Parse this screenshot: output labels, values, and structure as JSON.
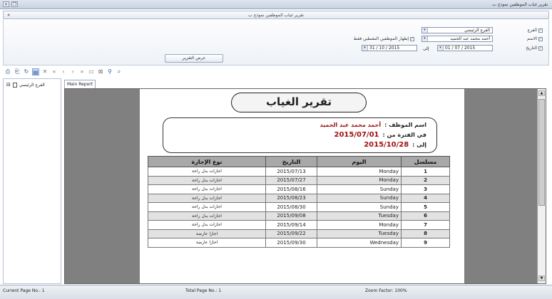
{
  "window": {
    "title": "تقرير غياب الموظفين نموذج ب"
  },
  "panel": {
    "title": "تقرير غياب الموظفين نموذج ب",
    "collapse": "«"
  },
  "filters": {
    "branch": {
      "label": "الفرع",
      "value": "الفرع الرئيسي",
      "checked": true
    },
    "name": {
      "label": "الاسم",
      "value": "أحمد محمد عبد الحميد",
      "checked": true
    },
    "active_only": {
      "label": "إظهار الموظفين النشطين فقط",
      "checked": true
    },
    "date": {
      "label": "التاريخ",
      "from": "01 / 07 / 2015",
      "to_label": "إلى",
      "to": "31 / 10 / 2015",
      "checked": true
    },
    "show_button": "عرض التقرير"
  },
  "toolbar": {
    "nav": [
      "«",
      "‹",
      "›",
      "»"
    ]
  },
  "tree": {
    "root": "الفرع الرئيسي",
    "expander": "⊟"
  },
  "tabs": {
    "main": "Main Report"
  },
  "report": {
    "title": "تقرير الغياب",
    "employee_label": "اسم الموظف :",
    "employee": "أحمد محمد عبد الحميد",
    "from_label": "في الفترة من :",
    "from": "2015/07/01",
    "to_label": "إلى :",
    "to": "2015/10/28",
    "columns": {
      "serial": "مسلسل",
      "day": "اليوم",
      "date": "التاريخ",
      "type": "نوع الإجازة"
    },
    "rows": [
      {
        "serial": "1",
        "day": "Monday",
        "date": "2015/07/13",
        "type": "اجازات بدل راحة"
      },
      {
        "serial": "2",
        "day": "Monday",
        "date": "2015/07/27",
        "type": "اجازات بدل راحة"
      },
      {
        "serial": "3",
        "day": "Sunday",
        "date": "2015/08/16",
        "type": "اجازات بدل راحة"
      },
      {
        "serial": "4",
        "day": "Sunday",
        "date": "2015/08/23",
        "type": "اجازات بدل راحة"
      },
      {
        "serial": "5",
        "day": "Sunday",
        "date": "2015/08/30",
        "type": "اجازات بدل راحة"
      },
      {
        "serial": "6",
        "day": "Tuesday",
        "date": "2015/09/08",
        "type": "اجازات بدل راحة"
      },
      {
        "serial": "7",
        "day": "Monday",
        "date": "2015/09/14",
        "type": "اجازات بدل راحة"
      },
      {
        "serial": "8",
        "day": "Tuesday",
        "date": "2015/09/22",
        "type": "اجازا عارضة"
      },
      {
        "serial": "9",
        "day": "Wednesday",
        "date": "2015/09/30",
        "type": "اجازا عارضة"
      }
    ]
  },
  "status": {
    "current": "Current Page No.: 1",
    "total": "Total Page No.: 1",
    "zoom": "Zoom Factor: 100%"
  }
}
